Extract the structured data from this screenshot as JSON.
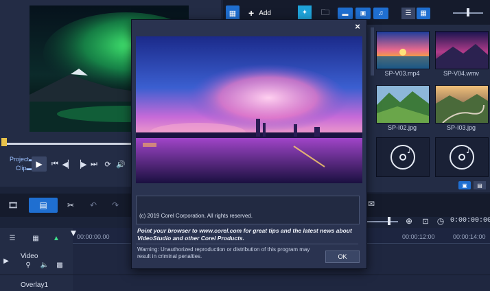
{
  "library": {
    "add_label": "Add",
    "media_items": [
      {
        "name": "SP-V03.mp4"
      },
      {
        "name": "SP-V04.wmv"
      },
      {
        "name": "SP-I02.jpg"
      },
      {
        "name": "SP-I03.jpg"
      },
      {
        "name": ""
      },
      {
        "name": ""
      }
    ]
  },
  "player": {
    "project_label": "Project",
    "clip_label": "Clip"
  },
  "timeline": {
    "timecode": "0:00:00:00",
    "ticks": [
      "00:00:00.00",
      "00:00:12:00",
      "00:00:14:00"
    ],
    "tracks": [
      {
        "name": "Video"
      },
      {
        "name": "Overlay1"
      }
    ]
  },
  "dialog": {
    "copyright": "(c) 2019 Corel Corporation. All rights reserved.",
    "tip": "Point your browser to www.corel.com for great tips and the latest news about VideoStudio and other Corel Products.",
    "warning": "Warning: Unauthorized reproduction or distribution of this program may result in criminal penalties.",
    "ok_label": "OK",
    "close_glyph": "×"
  },
  "colors": {
    "accent": "#1f6fd1",
    "panel": "#232c45",
    "background": "#1b2339"
  }
}
